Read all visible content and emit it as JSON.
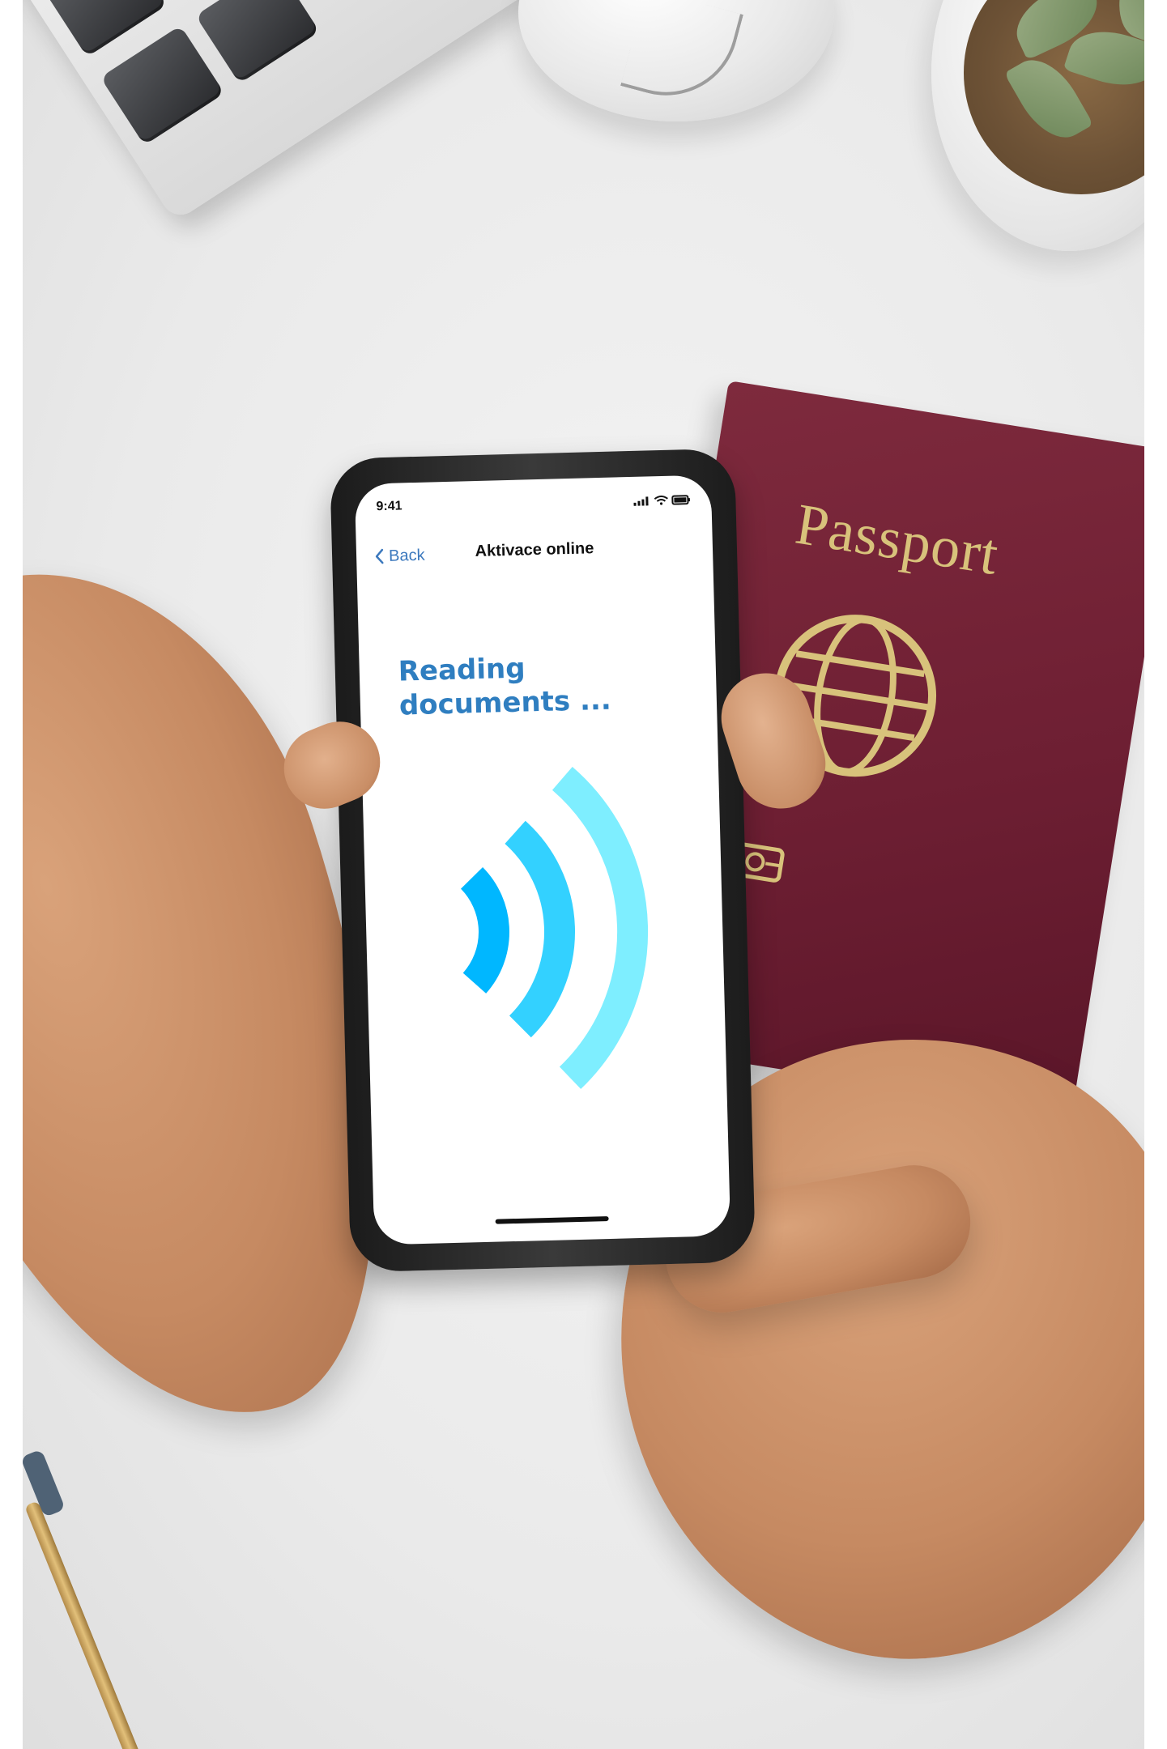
{
  "passport": {
    "title": "Passport",
    "colors": {
      "cover": "#6e1f33",
      "emblem": "#d8c27b"
    }
  },
  "phone": {
    "status_time": "9:41",
    "back_label": "Back",
    "nav_title": "Aktivace online",
    "heading": "Reading documents ...",
    "icons": [
      "signal-icon",
      "wifi-icon",
      "battery-icon",
      "chevron-left-icon",
      "nfc-waves-icon"
    ],
    "colors": {
      "accent": "#2f7ec0",
      "wave_inner": "#00b7ff",
      "wave_middle": "#33d1ff",
      "wave_outer": "#7eeeff"
    }
  }
}
